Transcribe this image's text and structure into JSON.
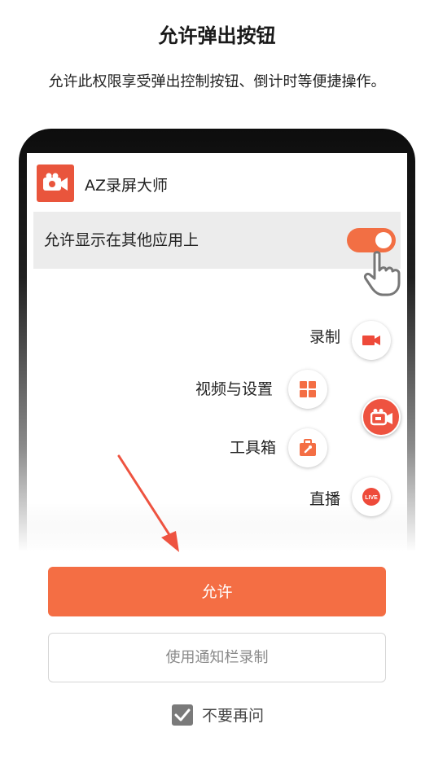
{
  "header": {
    "title": "允许弹出按钮",
    "subtitle": "允许此权限享受弹出控制按钮、倒计时等便捷操作。"
  },
  "mockup": {
    "app_name": "AZ录屏大师",
    "permission_label": "允许显示在其他应用上",
    "toggle_on": true,
    "menu": {
      "record": "录制",
      "video_settings": "视频与设置",
      "toolbox": "工具箱",
      "live": "直播",
      "live_badge": "LIVE"
    }
  },
  "actions": {
    "allow_label": "允许",
    "notification_record_label": "使用通知栏录制",
    "dont_ask_label": "不要再问",
    "dont_ask_checked": true
  },
  "colors": {
    "accent": "#f46e44",
    "app_icon": "#e9553c"
  }
}
